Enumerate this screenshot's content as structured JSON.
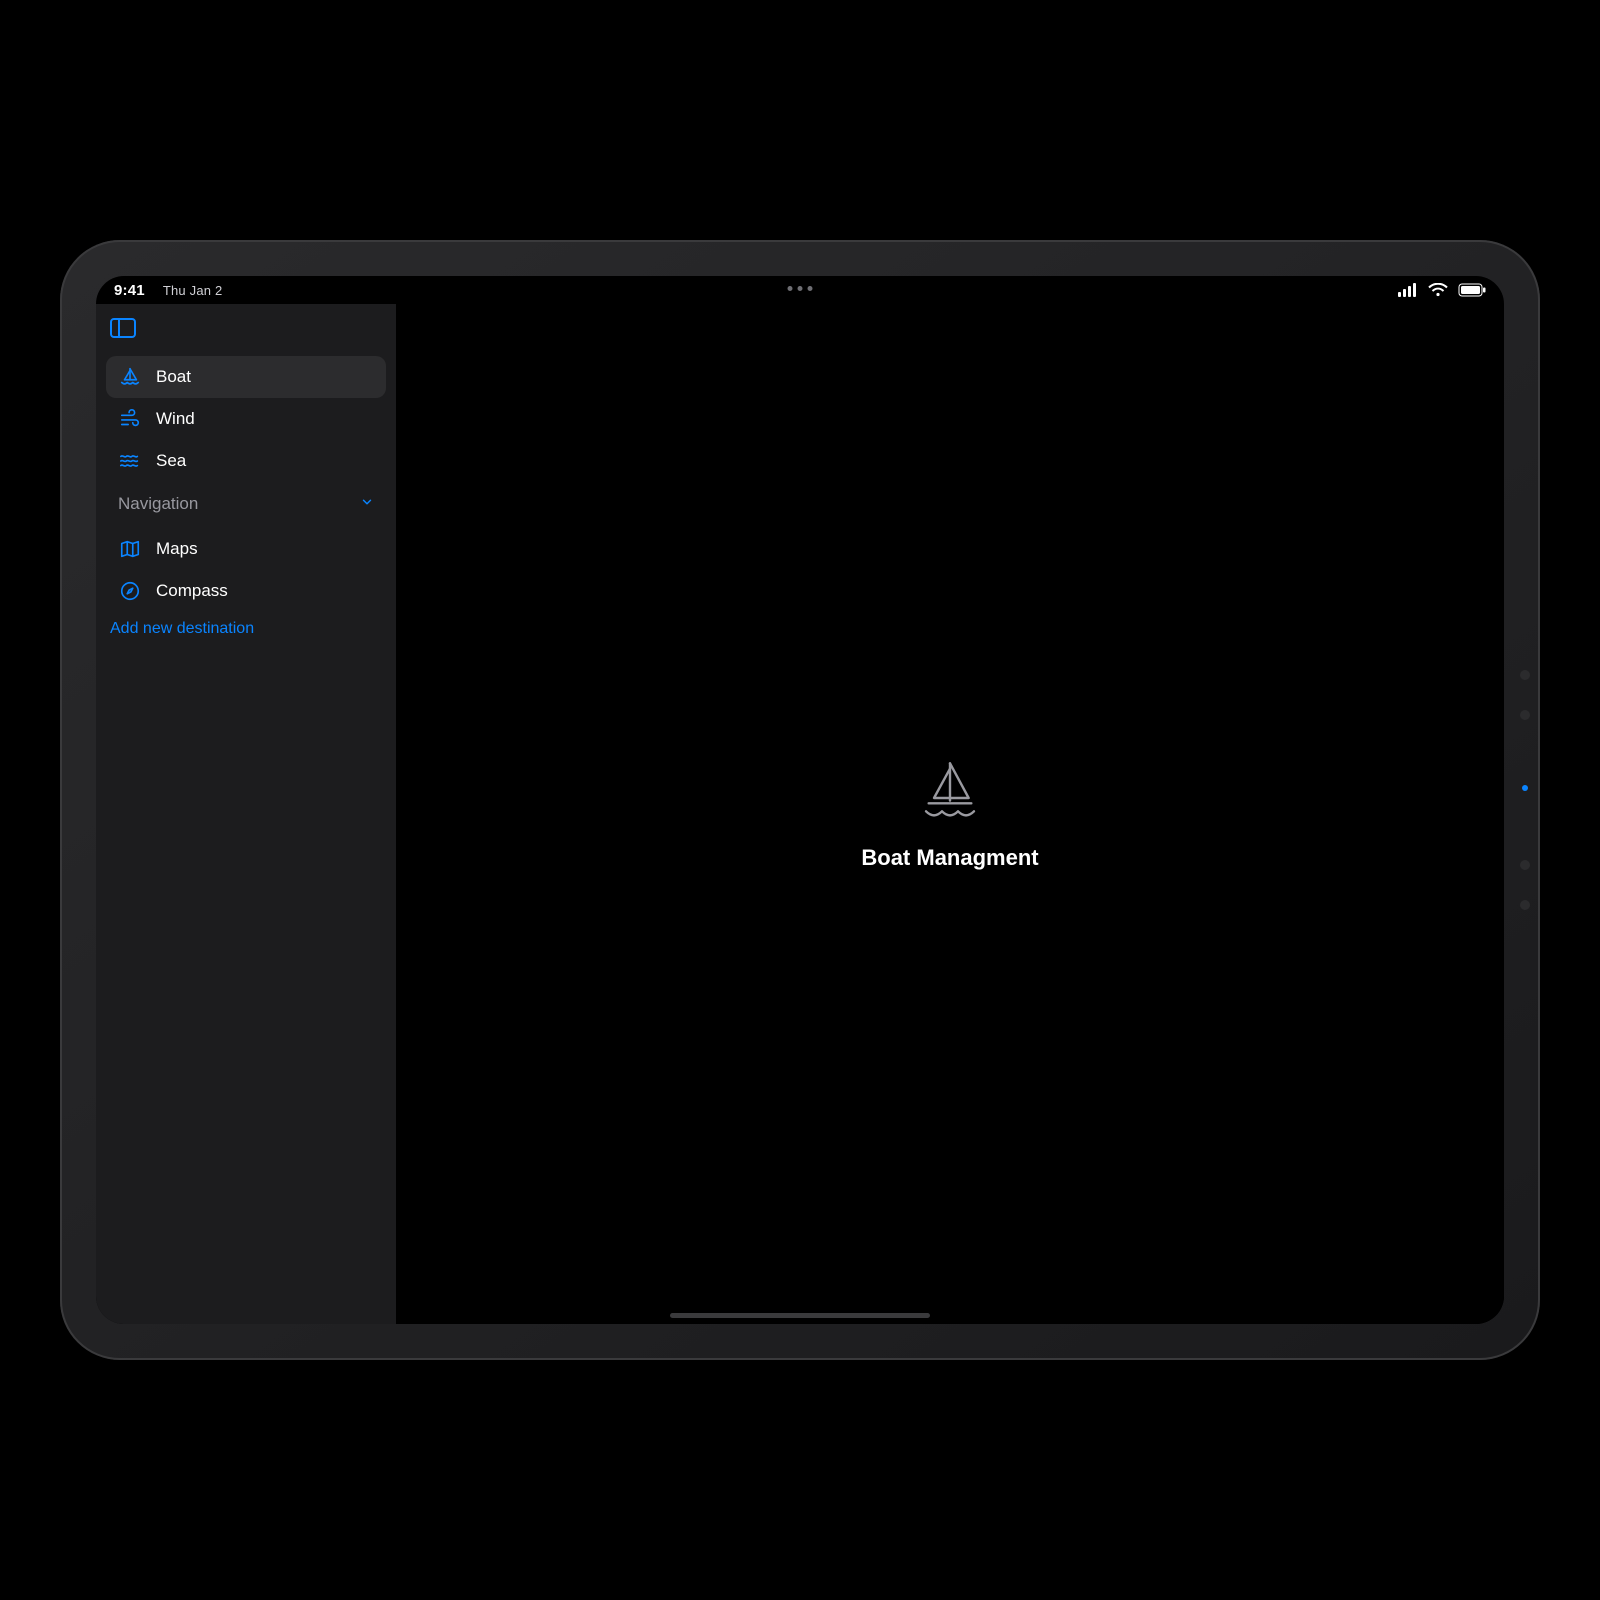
{
  "status": {
    "time": "9:41",
    "date": "Thu Jan 2"
  },
  "sidebar": {
    "items": [
      {
        "label": "Boat",
        "icon": "sailboat-icon",
        "selected": true
      },
      {
        "label": "Wind",
        "icon": "wind-icon",
        "selected": false
      },
      {
        "label": "Sea",
        "icon": "waves-icon",
        "selected": false
      }
    ],
    "section": {
      "title": "Navigation"
    },
    "nav_items": [
      {
        "label": "Maps",
        "icon": "map-icon"
      },
      {
        "label": "Compass",
        "icon": "compass-icon"
      }
    ],
    "add_link": "Add new destination"
  },
  "main": {
    "title": "Boat Managment"
  },
  "colors": {
    "accent": "#0a84ff",
    "sidebar_bg": "#1c1c1e",
    "sidebar_selected": "#2c2c2e",
    "main_bg": "#000000"
  }
}
